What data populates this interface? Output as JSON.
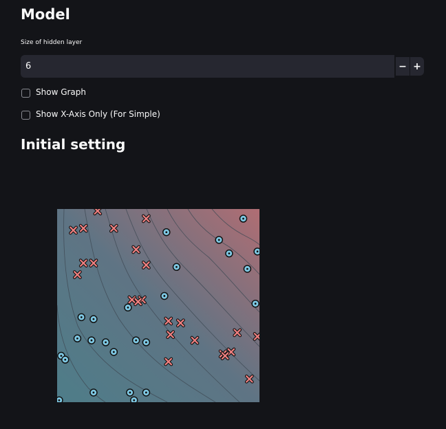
{
  "model": {
    "title": "Model",
    "hidden_layer_label": "Size of hidden layer",
    "hidden_layer_value": "6",
    "decrement_symbol": "−",
    "increment_symbol": "+"
  },
  "options": [
    {
      "label": "Show Graph",
      "checked": false
    },
    {
      "label": "Show X-Axis Only (For Simple)",
      "checked": false
    }
  ],
  "initial_setting": {
    "title": "Initial setting"
  },
  "plot": {
    "colors": {
      "class_cross": "#f08080",
      "class_circle": "#7ec8e3",
      "background_low": "#4e7d89",
      "background_high": "#b06d73"
    },
    "crosses": [
      [
        0.2,
        0.01
      ],
      [
        0.44,
        0.05
      ],
      [
        0.08,
        0.11
      ],
      [
        0.13,
        0.1
      ],
      [
        0.28,
        0.1
      ],
      [
        0.39,
        0.21
      ],
      [
        0.13,
        0.28
      ],
      [
        0.18,
        0.28
      ],
      [
        0.44,
        0.29
      ],
      [
        0.1,
        0.34
      ],
      [
        0.37,
        0.47
      ],
      [
        0.42,
        0.47
      ],
      [
        0.4,
        0.48
      ],
      [
        0.55,
        0.58
      ],
      [
        0.61,
        0.59
      ],
      [
        0.56,
        0.65
      ],
      [
        0.68,
        0.68
      ],
      [
        0.89,
        0.64
      ],
      [
        0.99,
        0.66
      ],
      [
        0.82,
        0.75
      ],
      [
        0.86,
        0.74
      ],
      [
        0.83,
        0.76
      ],
      [
        0.55,
        0.79
      ],
      [
        0.95,
        0.88
      ]
    ],
    "circles": [
      [
        0.92,
        0.05
      ],
      [
        0.54,
        0.12
      ],
      [
        0.8,
        0.16
      ],
      [
        0.85,
        0.23
      ],
      [
        0.99,
        0.22
      ],
      [
        0.59,
        0.3
      ],
      [
        0.94,
        0.31
      ],
      [
        0.53,
        0.45
      ],
      [
        0.98,
        0.49
      ],
      [
        0.35,
        0.51
      ],
      [
        0.12,
        0.56
      ],
      [
        0.18,
        0.57
      ],
      [
        0.1,
        0.67
      ],
      [
        0.17,
        0.68
      ],
      [
        0.24,
        0.69
      ],
      [
        0.28,
        0.74
      ],
      [
        0.39,
        0.68
      ],
      [
        0.44,
        0.69
      ],
      [
        0.02,
        0.76
      ],
      [
        0.04,
        0.78
      ],
      [
        0.18,
        0.95
      ],
      [
        0.36,
        0.95
      ],
      [
        0.44,
        0.95
      ],
      [
        0.38,
        0.99
      ],
      [
        0.01,
        0.99
      ]
    ]
  }
}
